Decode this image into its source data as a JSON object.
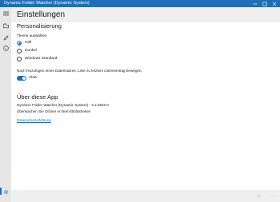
{
  "window": {
    "title": "Dynamic Folder Watcher (Dynamic System)"
  },
  "header": {
    "title": "Einstellungen"
  },
  "personalization": {
    "section_title": "Personalisierung",
    "theme_prompt": "Theme auswählen",
    "theme_options": [
      {
        "label": "Hell",
        "selected": true
      },
      {
        "label": "Dunkel",
        "selected": false
      },
      {
        "label": "Windows Standard",
        "selected": false
      }
    ],
    "scroll_setting_text": "Nach hinzufügen eines Datensatzes, Liste zu letztem Listeneintrag bewegen.",
    "toggle_label": "Aktiv",
    "toggle_on": true
  },
  "about": {
    "section_title": "Über diese App",
    "app_name_version": "Dynamic Folder Watcher (Dynamic System) - 3.2.3520.0",
    "description": "Überwachen Sie Ordner in Ihren Bibliotheken",
    "privacy_link": "Datenschutzerklärung"
  },
  "icons": {
    "menu": "hamburger-icon",
    "folders": "folders-icon",
    "edit": "pencil-icon",
    "info": "info-icon",
    "settings": "gear-icon",
    "add": "plus-icon",
    "more": "more-icon"
  },
  "colors": {
    "accent": "#1e6fb8",
    "sidebar": "#e6e6e6",
    "header": "#f0f0f0"
  }
}
